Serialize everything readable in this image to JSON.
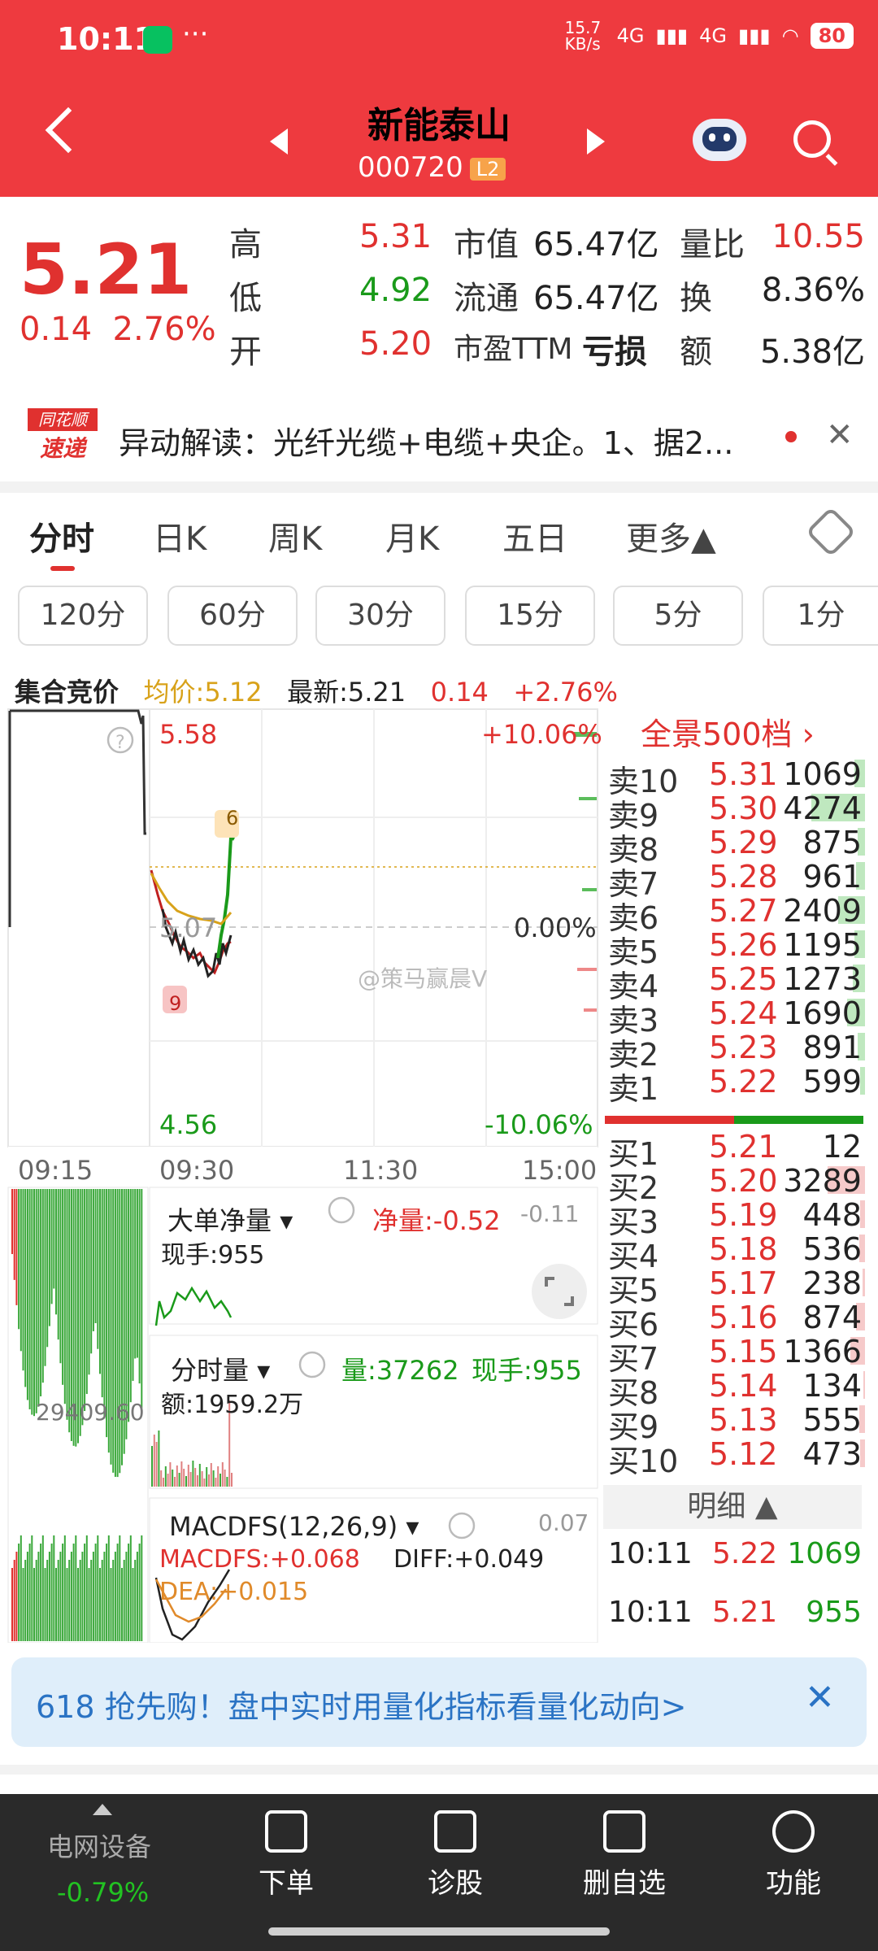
{
  "status": {
    "time": "10:11",
    "net_speed": "15.7 KB/s",
    "signal1": "4G",
    "signal2": "4G",
    "battery": "80"
  },
  "header": {
    "name": "新能泰山",
    "code": "000720",
    "badge": "L2"
  },
  "quote": {
    "price": "5.21",
    "change": "0.14",
    "pct": "2.76%",
    "high_label": "高",
    "high": "5.31",
    "low_label": "低",
    "low": "4.92",
    "open_label": "开",
    "open": "5.20",
    "mktcap_label": "市值",
    "mktcap": "65.47亿",
    "float_label": "流通",
    "float": "65.47亿",
    "pe_label": "市盈TTM",
    "pe": "亏损",
    "vr_label": "量比",
    "vr": "10.55",
    "turnover_label": "换",
    "turnover": "8.36%",
    "amount_label": "额",
    "amount": "5.38亿"
  },
  "news": {
    "logo_top": "同花顺",
    "logo_bottom": "速递",
    "text": "异动解读：光纤光缆+电缆+央企。1、据2..."
  },
  "tabs": [
    "分时",
    "日K",
    "周K",
    "月K",
    "五日",
    "更多▲"
  ],
  "periods": [
    "120分",
    "60分",
    "30分",
    "15分",
    "5分",
    "1分"
  ],
  "info": {
    "auction": "集合竞价",
    "avg": "均价:5.12",
    "latest": "最新:5.21",
    "chg": "0.14",
    "pct": "+2.76%"
  },
  "chart": {
    "top_price": "5.58",
    "top_pct": "+10.06%",
    "mid_price": "5.07",
    "mid_pct": "0.00%",
    "bot_price": "4.56",
    "bot_pct": "-10.06%",
    "times": [
      "09:15",
      "09:30",
      "11:30",
      "15:00"
    ],
    "marker_high": "6",
    "marker_low": "9",
    "left_value": "29409.60",
    "watermark": "@策马赢晨V"
  },
  "panels": {
    "big_order": "大单净量",
    "net_label": "净量:",
    "net_value": "-0.52",
    "net_right": "-0.11",
    "hand": "现手:955",
    "vol_title": "分时量",
    "vol_label": "量:37262",
    "vol_hand": "现手:955",
    "amount": "额:1959.2万",
    "macd_title": "MACDFS(12,26,9)",
    "macd_right": "0.07",
    "macd": "MACDFS:+0.068",
    "diff": "DIFF:+0.049",
    "dea": "DEA:+0.015"
  },
  "orderbook": {
    "title": "全景500档",
    "asks": [
      {
        "label": "卖10",
        "price": "5.31",
        "vol": "1069",
        "bar": 0.12
      },
      {
        "label": "卖9",
        "price": "5.30",
        "vol": "4274",
        "bar": 0.6
      },
      {
        "label": "卖8",
        "price": "5.29",
        "vol": "875",
        "bar": 0.08
      },
      {
        "label": "卖7",
        "price": "5.28",
        "vol": "961",
        "bar": 0.1
      },
      {
        "label": "卖6",
        "price": "5.27",
        "vol": "2409",
        "bar": 0.3
      },
      {
        "label": "卖5",
        "price": "5.26",
        "vol": "1195",
        "bar": 0.12
      },
      {
        "label": "卖4",
        "price": "5.25",
        "vol": "1273",
        "bar": 0.14
      },
      {
        "label": "卖3",
        "price": "5.24",
        "vol": "1690",
        "bar": 0.2
      },
      {
        "label": "卖2",
        "price": "5.23",
        "vol": "891",
        "bar": 0.08
      },
      {
        "label": "卖1",
        "price": "5.22",
        "vol": "599",
        "bar": 0.05
      }
    ],
    "bids": [
      {
        "label": "买1",
        "price": "5.21",
        "vol": "12",
        "bar": 0.0
      },
      {
        "label": "买2",
        "price": "5.20",
        "vol": "3289",
        "bar": 0.42
      },
      {
        "label": "买3",
        "price": "5.19",
        "vol": "448",
        "bar": 0.05
      },
      {
        "label": "买4",
        "price": "5.18",
        "vol": "536",
        "bar": 0.06
      },
      {
        "label": "买5",
        "price": "5.17",
        "vol": "238",
        "bar": 0.03
      },
      {
        "label": "买6",
        "price": "5.16",
        "vol": "874",
        "bar": 0.1
      },
      {
        "label": "买7",
        "price": "5.15",
        "vol": "1366",
        "bar": 0.16
      },
      {
        "label": "买8",
        "price": "5.14",
        "vol": "134",
        "bar": 0.02
      },
      {
        "label": "买9",
        "price": "5.13",
        "vol": "555",
        "bar": 0.06
      },
      {
        "label": "买10",
        "price": "5.12",
        "vol": "473",
        "bar": 0.05
      }
    ],
    "detail_title": "明细 ▲",
    "ticks": [
      {
        "time": "10:11",
        "price": "5.22",
        "vol": "1069"
      },
      {
        "time": "10:11",
        "price": "5.21",
        "vol": "955"
      }
    ]
  },
  "promo": {
    "text": "618 抢先购！盘中实时用量化指标看量化动向>"
  },
  "bottom": {
    "sector": "电网设备",
    "sector_pct": "-0.79%",
    "items": [
      "下单",
      "诊股",
      "删自选",
      "功能"
    ]
  },
  "colors": {
    "header": "#ee3a3f",
    "up": "#e0312f",
    "down": "#1a9a1a"
  }
}
